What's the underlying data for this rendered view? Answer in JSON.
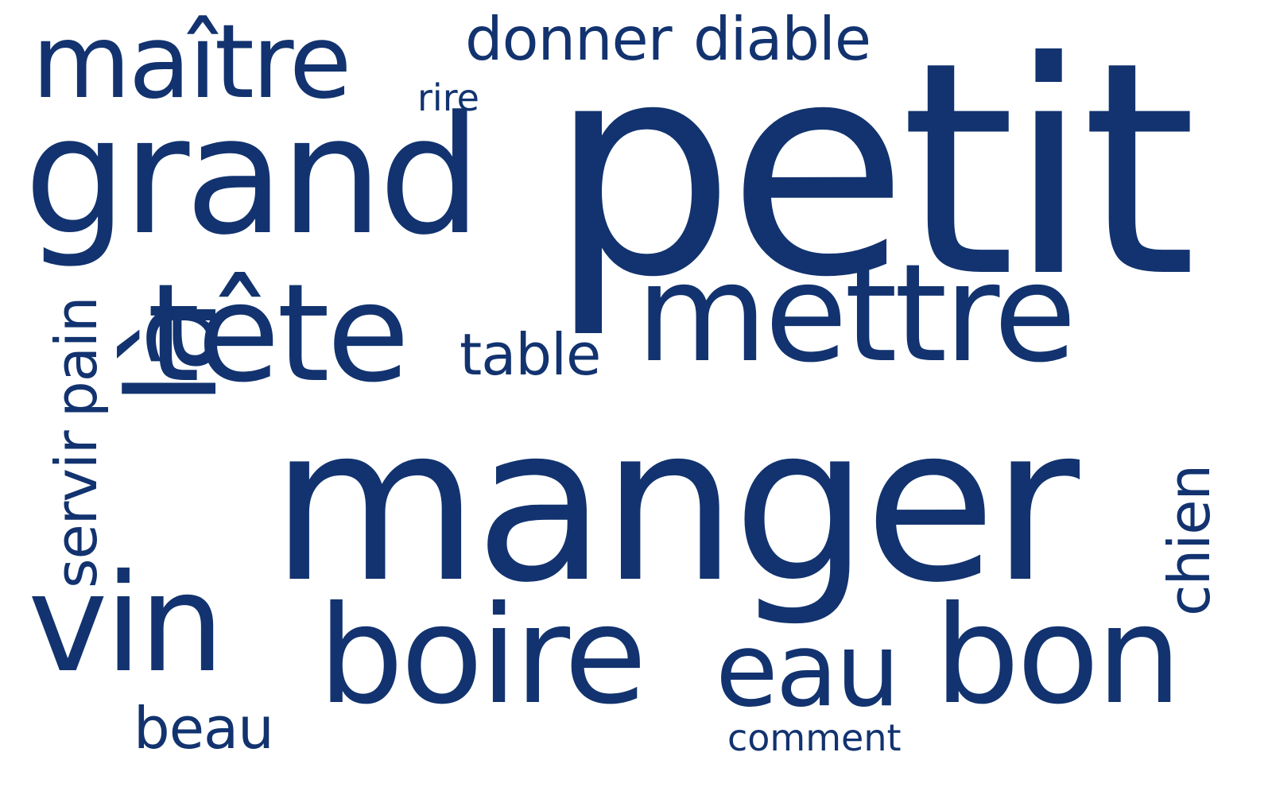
{
  "cloud": {
    "color": "#12336f",
    "background": "#ffffff",
    "words": {
      "petit": "petit",
      "manger": "manger",
      "grand": "grand",
      "mettre": "mettre",
      "tete": "tête",
      "boire": "boire",
      "vin": "vin",
      "bon": "bon",
      "la": "là",
      "maitre": "maître",
      "eau": "eau",
      "donner": "donner",
      "diable": "diable",
      "table": "table",
      "servir": "servir",
      "pain": "pain",
      "chien": "chien",
      "beau": "beau",
      "rire": "rire",
      "comment": "comment"
    }
  }
}
